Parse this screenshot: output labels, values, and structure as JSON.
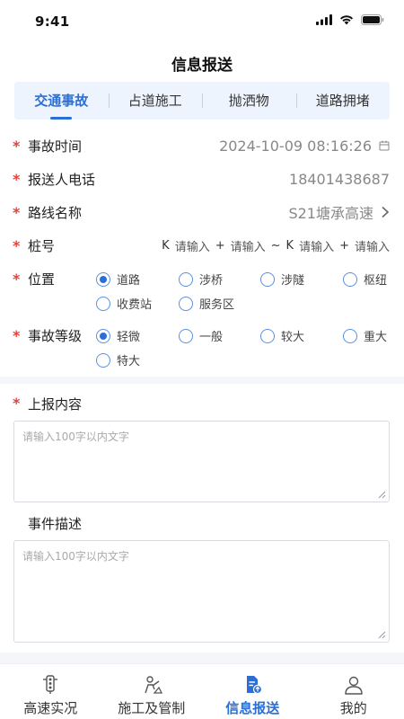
{
  "status_bar": {
    "time": "9:41"
  },
  "header": {
    "title": "信息报送"
  },
  "tabs": [
    {
      "label": "交通事故",
      "active": true
    },
    {
      "label": "占道施工",
      "active": false
    },
    {
      "label": "抛洒物",
      "active": false
    },
    {
      "label": "道路拥堵",
      "active": false
    }
  ],
  "form": {
    "accident_time": {
      "label": "事故时间",
      "value": "2024-10-09 08:16:26"
    },
    "reporter_phone": {
      "label": "报送人电话",
      "value": "18401438687"
    },
    "route": {
      "label": "路线名称",
      "value": "S21塘承高速"
    },
    "pile": {
      "label": "桩号",
      "k1": "K",
      "ph1": "请输入",
      "plus1": "+",
      "ph2": "请输入",
      "tilde": "~",
      "k2": "K",
      "ph3": "请输入",
      "plus2": "+",
      "ph4": "请输入"
    },
    "location": {
      "label": "位置",
      "options": [
        "道路",
        "涉桥",
        "涉隧",
        "枢纽",
        "收费站",
        "服务区"
      ],
      "selected": "道路"
    },
    "severity": {
      "label": "事故等级",
      "options": [
        "轻微",
        "一般",
        "较大",
        "重大",
        "特大"
      ],
      "selected": "轻微"
    },
    "report_content": {
      "label": "上报内容",
      "placeholder": "请输入100字以内文字"
    },
    "event_description": {
      "label": "事件描述",
      "placeholder": "请输入100字以内文字"
    }
  },
  "bottom_nav": [
    {
      "label": "高速实况",
      "icon": "traffic-light-icon",
      "active": false
    },
    {
      "label": "施工及管制",
      "icon": "construction-worker-icon",
      "active": false
    },
    {
      "label": "信息报送",
      "icon": "report-upload-icon",
      "active": true
    },
    {
      "label": "我的",
      "icon": "user-icon",
      "active": false
    }
  ],
  "colors": {
    "accent": "#2b6fd6",
    "required": "#e0443c",
    "tab_bg": "#eef4fd"
  }
}
